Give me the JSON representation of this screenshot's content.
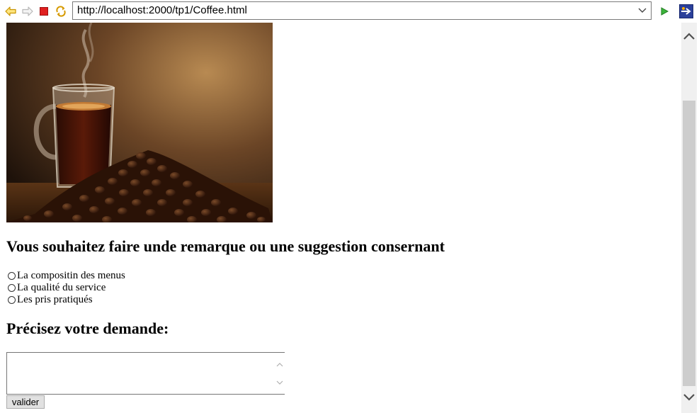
{
  "browser": {
    "url": "http://localhost:2000/tp1/Coffee.html",
    "back_icon": "back-arrow-icon",
    "forward_icon": "forward-arrow-icon",
    "stop_icon": "stop-icon",
    "refresh_icon": "refresh-icon",
    "go_icon": "go-play-icon",
    "app_icon": "eclipse-browser-icon"
  },
  "page": {
    "image_alt": "coffee-cup-with-beans",
    "question_heading": "Vous souhaitez faire unde remarque ou une suggestion consernant",
    "options": [
      "La compositin des menus",
      "La qualité du service",
      "Les pris pratiqués"
    ],
    "request_heading": "Précisez votre demande:",
    "textarea_value": "",
    "submit_label": "valider"
  },
  "colors": {
    "back_arrow": "#e8b400",
    "stop": "#e02020",
    "go": "#2ea02e",
    "scroll_thumb": "#cdcdcd"
  }
}
